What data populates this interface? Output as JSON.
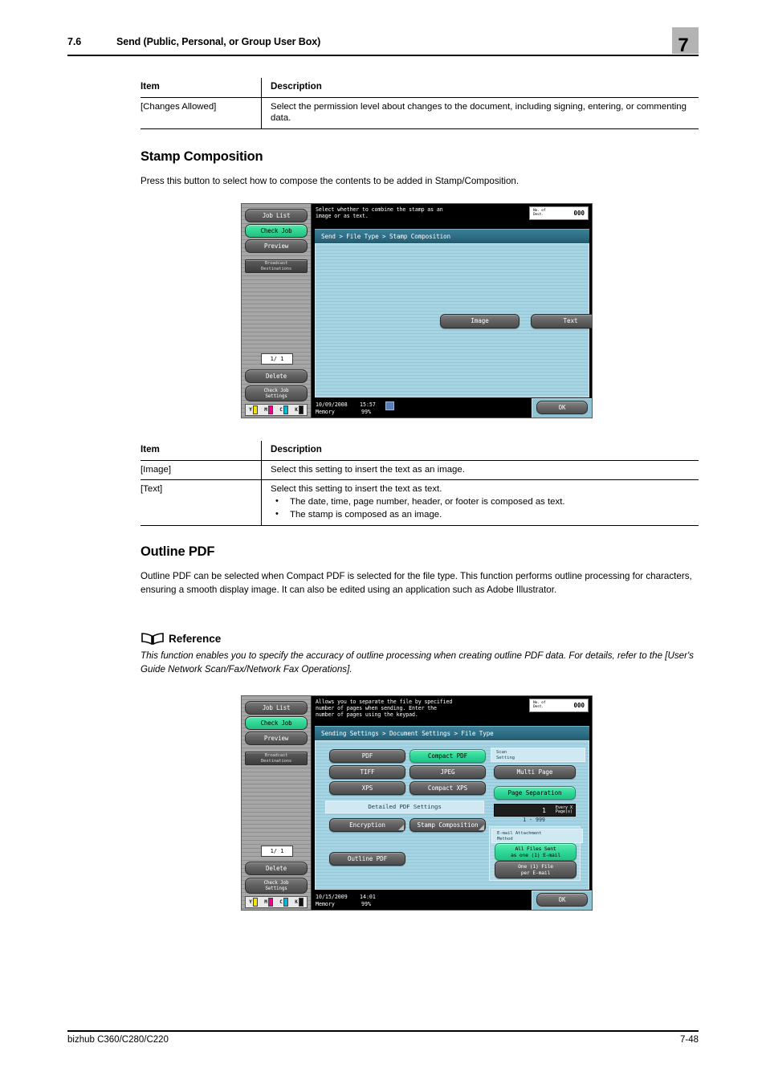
{
  "header": {
    "section_number": "7.6",
    "section_title": "Send (Public, Personal, or Group User Box)",
    "chapter_number": "7"
  },
  "footer": {
    "product": "bizhub C360/C280/C220",
    "page_number": "7-48"
  },
  "table1": {
    "headers": {
      "item": "Item",
      "description": "Description"
    },
    "rows": [
      {
        "item": "[Changes Allowed]",
        "description": "Select the permission level about changes to the document, including signing, entering, or commenting data."
      }
    ]
  },
  "section_stamp": {
    "heading": "Stamp Composition",
    "paragraph": "Press this button to select how to compose the contents to be added in Stamp/Composition."
  },
  "table2": {
    "headers": {
      "item": "Item",
      "description": "Description"
    },
    "rows": [
      {
        "item": "[Image]",
        "description": "Select this setting to insert the text as an image."
      },
      {
        "item": "[Text]",
        "description": "Select this setting to insert the text as text.",
        "bullets": [
          "The date, time, page number, header, or footer is composed as text.",
          "The stamp is composed as an image."
        ]
      }
    ]
  },
  "section_outline": {
    "heading": "Outline PDF",
    "paragraph": "Outline PDF can be selected when Compact PDF is selected for the file type. This function performs outline processing for characters, ensuring a smooth display image. It can also be edited using an application such as Adobe Illustrator.",
    "reference_label": "Reference",
    "reference_text": "This function enables you to specify the accuracy of outline processing when creating outline PDF data. For details, refer to the [User's Guide Network Scan/Fax/Network Fax Operations]."
  },
  "panel1": {
    "message": "Select whether to combine the stamp as an\nimage or as text.",
    "dest_label_line1": "No. of",
    "dest_label_line2": "Dest.",
    "dest_value": "000",
    "breadcrumb": "Send > File Type > Stamp Composition",
    "sidebar": {
      "job_list": "Job List",
      "check_job": "Check Job",
      "preview": "Preview",
      "broadcast_line1": "Broadcast",
      "broadcast_line2": "Destinations",
      "page_counter": "1/  1",
      "delete": "Delete",
      "check_job_settings_line1": "Check Job",
      "check_job_settings_line2": "Settings",
      "toner": [
        {
          "label": "Y",
          "color": "#f2e200"
        },
        {
          "label": "M",
          "color": "#ec008c"
        },
        {
          "label": "C",
          "color": "#00b6d6"
        },
        {
          "label": "K",
          "color": "#101010"
        }
      ]
    },
    "buttons": {
      "image": "Image",
      "text": "Text"
    },
    "status": {
      "date": "10/09/2008",
      "time": "15:57",
      "memory_label": "Memory",
      "memory_value": "99%"
    },
    "ok": "OK"
  },
  "panel2": {
    "message": "Allows you to separate the file by specified\nnumber of pages when sending. Enter the\nnumber of pages using the keypad.",
    "dest_label_line1": "No. of",
    "dest_label_line2": "Dest.",
    "dest_value": "000",
    "breadcrumb": "Sending Settings > Document Settings > File Type",
    "sidebar": {
      "job_list": "Job List",
      "check_job": "Check Job",
      "preview": "Preview",
      "broadcast_line1": "Broadcast",
      "broadcast_line2": "Destinations",
      "page_counter": "1/  1",
      "delete": "Delete",
      "check_job_settings_line1": "Check Job",
      "check_job_settings_line2": "Settings",
      "toner": [
        {
          "label": "Y",
          "color": "#f2e200"
        },
        {
          "label": "M",
          "color": "#ec008c"
        },
        {
          "label": "C",
          "color": "#00b6d6"
        },
        {
          "label": "K",
          "color": "#101010"
        }
      ]
    },
    "file_types": {
      "pdf": "PDF",
      "compact_pdf": "Compact PDF",
      "tiff": "TIFF",
      "jpeg": "JPEG",
      "xps": "XPS",
      "compact_xps": "Compact XPS"
    },
    "detailed_pdf_label": "Detailed PDF Settings",
    "detailed_buttons": {
      "encryption": "Encryption",
      "stamp_composition": "Stamp Composition",
      "outline_pdf": "Outline PDF"
    },
    "scan_setting": {
      "label_line1": "Scan",
      "label_line2": "Setting",
      "multi_page": "Multi Page",
      "page_separation": "Page Separation",
      "every_value": "1",
      "every_label_line1": "Every X",
      "every_label_line2": "Page(s)",
      "range": "1  -  999"
    },
    "email_attachment": {
      "label_line1": "E-mail Attachment",
      "label_line2": "Method",
      "all_files_line1": "All Files Sent",
      "all_files_line2": "as one (1) E-mail",
      "one_file_line1": "One (1) File",
      "one_file_line2": "per E-mail"
    },
    "status": {
      "date": "10/15/2009",
      "time": "14:01",
      "memory_label": "Memory",
      "memory_value": "99%"
    },
    "ok": "OK"
  },
  "colors": {
    "accent_green": "#2ed898",
    "breadcrumb_blue": "#2c6b82",
    "panel_bg": "#9dcddd",
    "chapter_tab_gray": "#b3b3b3"
  }
}
